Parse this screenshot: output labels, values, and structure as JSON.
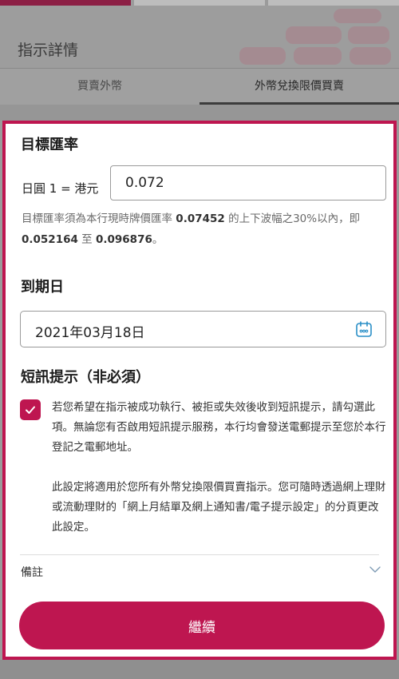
{
  "header": {
    "title": "指示詳情"
  },
  "tabs": [
    {
      "label": "買賣外幣",
      "selected": false
    },
    {
      "label": "外幣兌換限價買賣",
      "selected": true
    }
  ],
  "target_rate": {
    "section_title": "目標匯率",
    "prefix": "日圓 1 = 港元",
    "value": "0.072",
    "hint": {
      "part1": "目標匯率須為本行現時牌價匯率 ",
      "current_rate": "0.07452",
      "part2": " 的上下波幅之30%以內，即 ",
      "min": "0.052164",
      "part3": " 至 ",
      "max": "0.096876",
      "part4": "。"
    }
  },
  "expiry": {
    "section_title": "到期日",
    "value": "2021年03月18日",
    "icon": "calendar-icon"
  },
  "sms": {
    "section_title": "短訊提示（非必須）",
    "checked": true,
    "paragraph1": "若您希望在指示被成功執行、被拒或失效後收到短訊提示，請勾選此項。無論您有否啟用短訊提示服務，本行均會發送電郵提示至您於本行登記之電郵地址。",
    "paragraph2": "此設定將適用於您所有外幣兌換限價買賣指示。您可隨時透過網上理財或流動理財的「網上月結單及網上通知書/電子提示設定」的分頁更改此設定。"
  },
  "remarks": {
    "label": "備註",
    "icon": "chevron-down-icon"
  },
  "continue_button": {
    "label": "繼續"
  },
  "colors": {
    "accent": "#be1650",
    "overlay": "#9b9b9b"
  }
}
